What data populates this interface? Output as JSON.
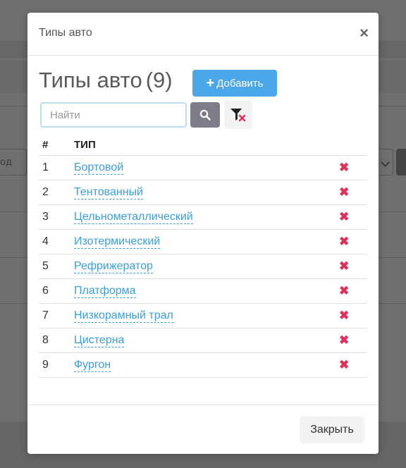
{
  "background": {
    "select_partial_text": "од"
  },
  "modal": {
    "title": "Типы авто",
    "close_symbol": "×",
    "heading": "Типы авто",
    "count": "(9)",
    "add_button": {
      "icon": "+",
      "label": "Добавить"
    },
    "search": {
      "placeholder": "Найти",
      "value": ""
    },
    "search_button_icon": "search-icon",
    "clear_filter_icon": "filter-clear-icon",
    "table": {
      "headers": {
        "num": "#",
        "type": "ТИП"
      },
      "rows": [
        {
          "num": "1",
          "type": "Бортовой"
        },
        {
          "num": "2",
          "type": "Тентованный"
        },
        {
          "num": "3",
          "type": "Цельнометаллический"
        },
        {
          "num": "4",
          "type": "Изотермический"
        },
        {
          "num": "5",
          "type": "Рефрижератор"
        },
        {
          "num": "6",
          "type": "Платформа"
        },
        {
          "num": "7",
          "type": "Низкорамный трал"
        },
        {
          "num": "8",
          "type": "Цистерна"
        },
        {
          "num": "9",
          "type": "Фургон"
        }
      ],
      "delete_symbol": "✖"
    },
    "footer": {
      "close_button": "Закрыть"
    }
  },
  "colors": {
    "accent": "#4aa8ea",
    "link": "#3a9ee0",
    "delete": "#e0305a",
    "overlay": "#707070"
  }
}
